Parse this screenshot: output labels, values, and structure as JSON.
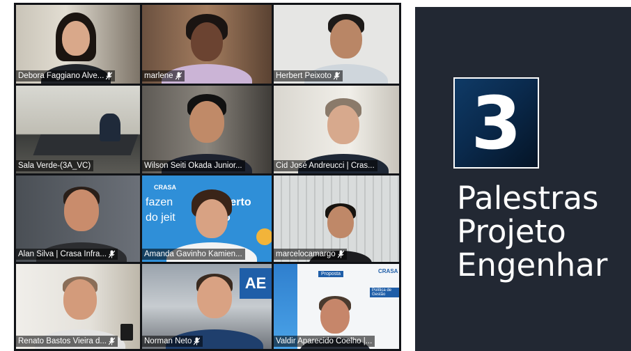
{
  "meeting": {
    "participants": [
      {
        "name": "Debora Faggiano Alve...",
        "muted": true
      },
      {
        "name": "marlene",
        "muted": true
      },
      {
        "name": "Herbert Peixoto",
        "muted": true
      },
      {
        "name": "Sala Verde-(3A_VC)",
        "muted": false
      },
      {
        "name": "Wilson Seiti Okada Junior...",
        "muted": false
      },
      {
        "name": "Cid José Andreucci | Cras...",
        "muted": false
      },
      {
        "name": "Alan Silva | Crasa Infra...",
        "muted": true
      },
      {
        "name": "Amanda Gavinho Kamien...",
        "muted": false
      },
      {
        "name": "marcelocamargo",
        "muted": true
      },
      {
        "name": "Renato Bastos Vieira d...",
        "muted": true
      },
      {
        "name": "Norman Neto",
        "muted": true
      },
      {
        "name": "Valdir Aparecido Coelho |...",
        "muted": false
      }
    ],
    "banner": {
      "brand": "CRASA",
      "line1": "fazen",
      "line1b": "é certo",
      "line2": "do jeit",
      "line2b": "to"
    },
    "wall_sign": "AE",
    "slide_doc": {
      "brand": "CRASA",
      "heading": "Proposta",
      "sub": "Política de Gestão"
    }
  },
  "slide": {
    "number": "3",
    "title_lines": [
      "Palestras",
      "Projeto",
      "Engenhar"
    ]
  },
  "colors": {
    "panel_bg": "#222833",
    "number_box": "#0a2a4d",
    "text": "#ffffff"
  }
}
